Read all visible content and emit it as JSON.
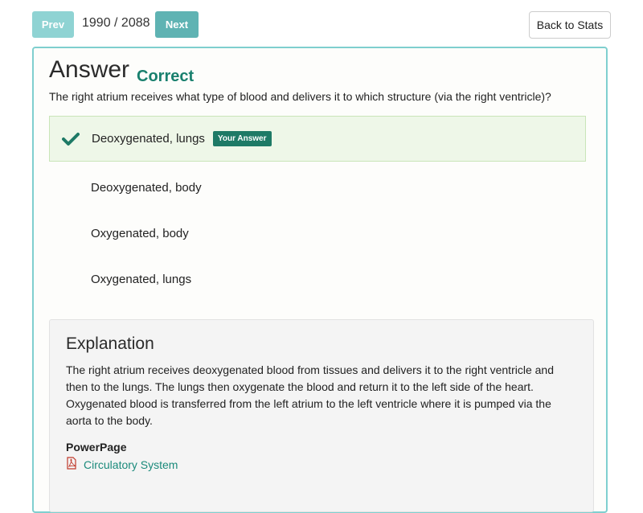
{
  "nav": {
    "prev_label": "Prev",
    "counter": "1990 / 2088",
    "next_label": "Next",
    "back_label": "Back to Stats"
  },
  "answer": {
    "title": "Answer",
    "result": "Correct",
    "question": "The right atrium receives what type of blood and delivers it to which structure (via the right ventricle)?"
  },
  "choices": [
    {
      "label": "Deoxygenated, lungs",
      "badge": "Your Answer",
      "selected": true
    },
    {
      "label": "Deoxygenated, body"
    },
    {
      "label": "Oxygenated, body"
    },
    {
      "label": "Oxygenated, lungs"
    }
  ],
  "explanation": {
    "title": "Explanation",
    "body": "The right atrium receives deoxygenated blood from tissues and delivers it to the right ventricle and then to the lungs. The lungs then oxygenate the blood and return it to the left side of the heart. Oxygenated blood is transferred from the left atrium to the left ventricle where it is pumped via the aorta to the body.",
    "powerpage_label": "PowerPage",
    "powerpage_link": "Circulatory System"
  },
  "colors": {
    "accent": "#19806e",
    "card_border": "#7fcfcf",
    "selected_bg": "#eef7e8"
  },
  "icons": {
    "check": "check-icon",
    "pdf": "pdf-icon"
  }
}
